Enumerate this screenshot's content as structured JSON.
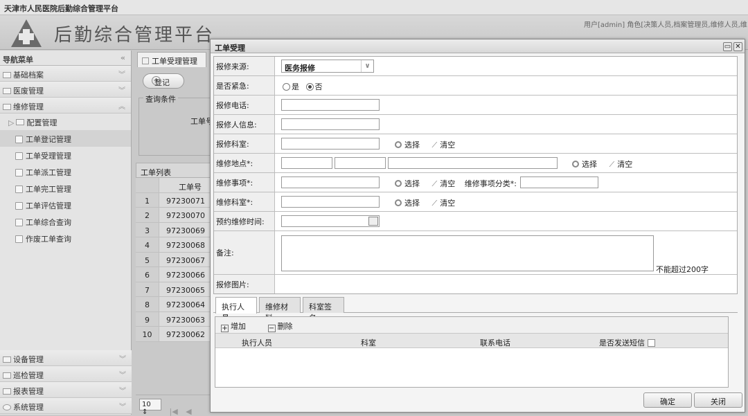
{
  "window_title": "天津市人民医院后勤综合管理平台",
  "header": {
    "brand": "后勤综合管理平台",
    "user_info": "用户[admin]  角色[决策人员,档案管理员,维修人员,维"
  },
  "sidebar": {
    "title": "导航菜单",
    "sections_top": [
      {
        "label": "基础档案"
      },
      {
        "label": "医废管理"
      },
      {
        "label": "维修管理"
      }
    ],
    "config_label": "配置管理",
    "items": [
      {
        "label": "工单登记管理",
        "active": true
      },
      {
        "label": "工单受理管理"
      },
      {
        "label": "工单派工管理"
      },
      {
        "label": "工单完工管理"
      },
      {
        "label": "工单评估管理"
      },
      {
        "label": "工单综合查询"
      },
      {
        "label": "作废工单查询"
      }
    ],
    "sections_bottom": [
      {
        "label": "设备管理"
      },
      {
        "label": "巡检管理"
      },
      {
        "label": "报表管理"
      },
      {
        "label": "系统管理"
      }
    ]
  },
  "main": {
    "tab_label": "工单受理管理",
    "register_button": "登记",
    "query_legend": "查询条件",
    "query_field_label": "工单号",
    "list_title": "工单列表",
    "column_header": "工单号",
    "rows": [
      {
        "n": "1",
        "id": "97230071"
      },
      {
        "n": "2",
        "id": "97230070"
      },
      {
        "n": "3",
        "id": "97230069"
      },
      {
        "n": "4",
        "id": "97230068"
      },
      {
        "n": "5",
        "id": "97230067"
      },
      {
        "n": "6",
        "id": "97230066"
      },
      {
        "n": "7",
        "id": "97230065"
      },
      {
        "n": "8",
        "id": "97230064"
      },
      {
        "n": "9",
        "id": "97230063"
      },
      {
        "n": "10",
        "id": "97230062"
      }
    ],
    "page_size": "10"
  },
  "dialog": {
    "title": "工单受理",
    "labels": {
      "source": "报修来源:",
      "urgent": "是否紧急:",
      "phone": "报修电话:",
      "reporter": "报修人信息:",
      "dept": "报修科室:",
      "location": "维修地点*:",
      "item": "维修事项*:",
      "item_category": "维修事项分类*:",
      "repair_dept": "维修科室*:",
      "appointment": "预约维修时间:",
      "remark": "备注:",
      "photo": "报修图片:"
    },
    "source_value": "医务报修",
    "radio_yes": "是",
    "radio_no": "否",
    "urgent_selected": "否",
    "select_label": "选择",
    "clear_label": "清空",
    "remark_hint": "不能超过200字",
    "tabs": [
      "执行人员",
      "维修材料",
      "科室签名"
    ],
    "active_tab": "执行人员",
    "add_label": "增加",
    "delete_label": "删除",
    "columns": [
      "执行人员",
      "科室",
      "联系电话",
      "是否发送短信"
    ],
    "confirm": "确定",
    "close": "关闭"
  }
}
